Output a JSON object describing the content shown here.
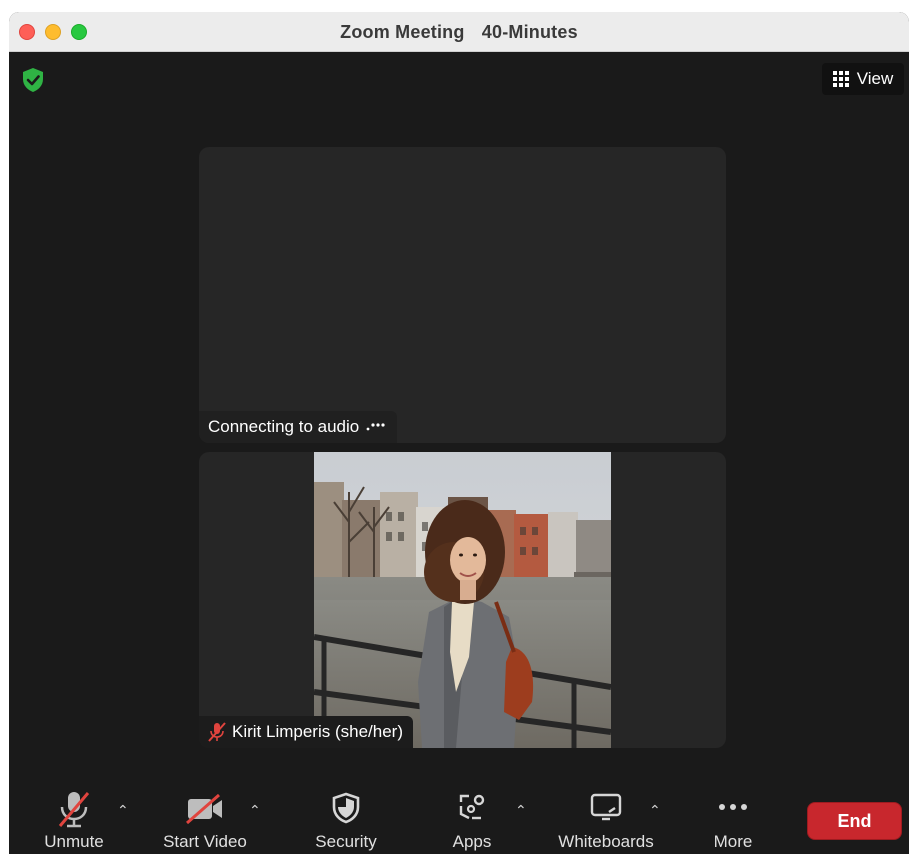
{
  "window": {
    "title_app": "Zoom Meeting",
    "title_duration": "40-Minutes"
  },
  "header": {
    "view_label": "View"
  },
  "tiles": [
    {
      "status_text": "Connecting to audio"
    },
    {
      "participant_name": "Kirit Limperis (she/her)"
    }
  ],
  "toolbar": {
    "unmute_label": "Unmute",
    "start_video_label": "Start Video",
    "security_label": "Security",
    "apps_label": "Apps",
    "whiteboards_label": "Whiteboards",
    "more_label": "More",
    "end_label": "End"
  },
  "colors": {
    "end_button": "#c8272d",
    "encryption_shield": "#2fb344",
    "muted_red": "#e0443e"
  }
}
